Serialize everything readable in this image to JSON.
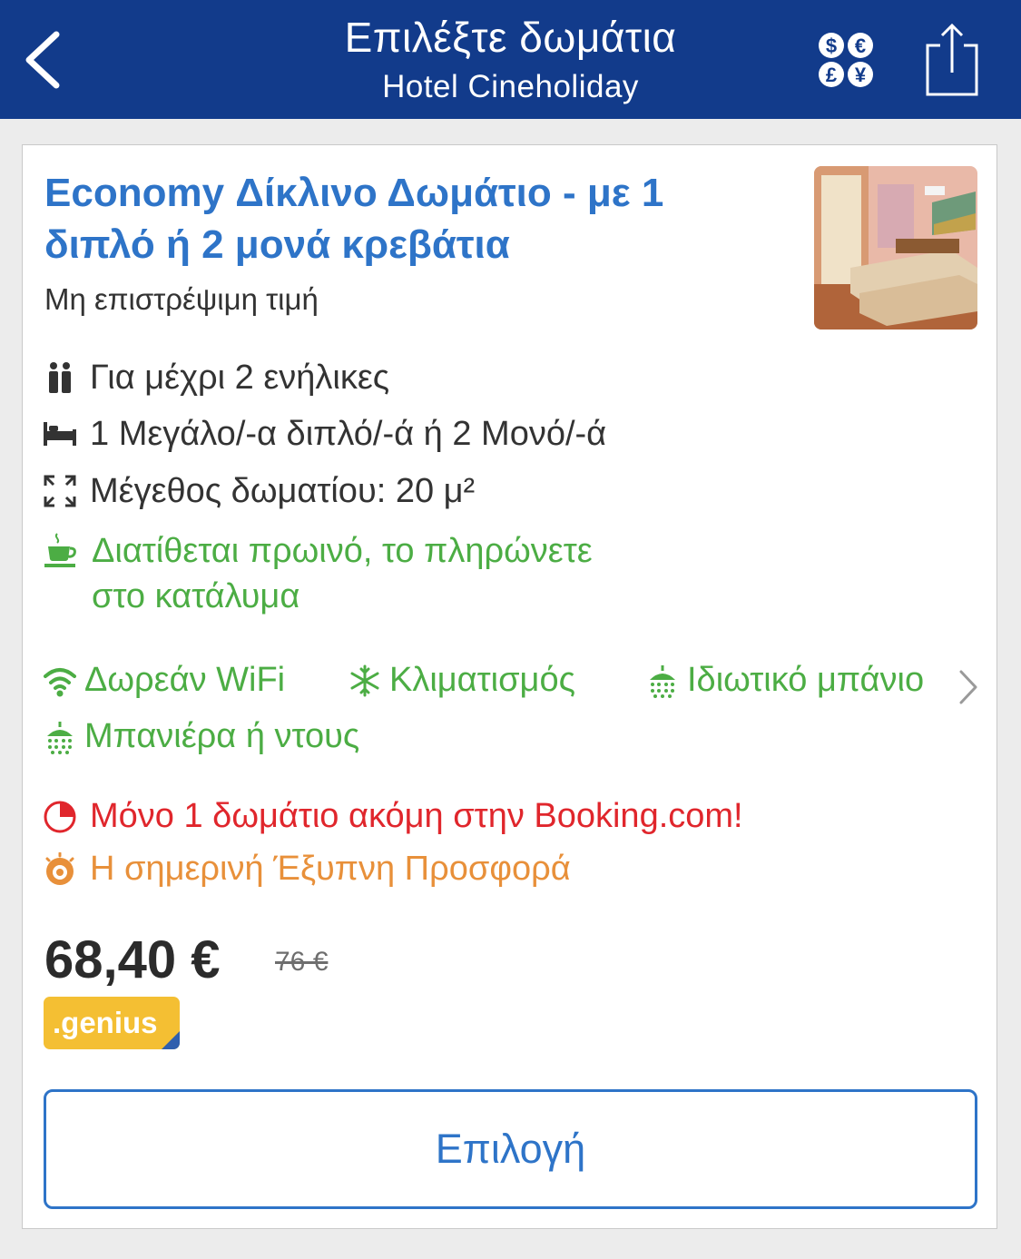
{
  "header": {
    "title": "Επιλέξτε δωμάτια",
    "subtitle": "Hotel Cineholiday",
    "back_icon": "chevron-left-icon",
    "currency_icon": "currency-icon",
    "share_icon": "share-icon",
    "currency_symbols": [
      "$",
      "€",
      "£",
      "¥"
    ]
  },
  "room": {
    "title": "Economy Δίκλινο Δωμάτιο - με 1 διπλό ή 2 μονά κρεβάτια",
    "policy": "Μη επιστρέψιμη τιμή",
    "features": [
      {
        "icon": "guests-icon",
        "text": "Για μέχρι 2 ενήλικες"
      },
      {
        "icon": "bed-icon",
        "text": "1 Μεγάλο/-α διπλό/-ά ή 2 Μονό/-ά"
      },
      {
        "icon": "room-size-icon",
        "text": "Μέγεθος δωματίου: 20 μ²"
      }
    ],
    "breakfast": {
      "icon": "coffee-cup-icon",
      "line1": "Διατίθεται πρωινό, το πληρώνετε",
      "line2": "στο κατάλυμα"
    },
    "facilities": [
      {
        "icon": "wifi-icon",
        "text": "Δωρεάν WiFi"
      },
      {
        "icon": "snowflake-icon",
        "text": "Κλιματισμός"
      },
      {
        "icon": "shower-icon",
        "text": "Ιδιωτικό μπάνιο"
      },
      {
        "icon": "shower-icon",
        "text": "Μπανιέρα ή ντους"
      }
    ],
    "availability_alert": "Μόνο 1 δωμάτιο ακόμη στην Booking.com!",
    "deal_label": "Η σημερινή Έξυπνη Προσφορά",
    "price": "68,40 €",
    "original_price": "76 €",
    "genius_badge": ".genius",
    "select_button": "Επιλογή"
  },
  "colors": {
    "header_bg": "#123b8b",
    "link_blue": "#2e74c8",
    "green": "#4cad44",
    "red": "#e0262c",
    "orange": "#e8903a",
    "genius_yellow": "#f4bf33"
  }
}
